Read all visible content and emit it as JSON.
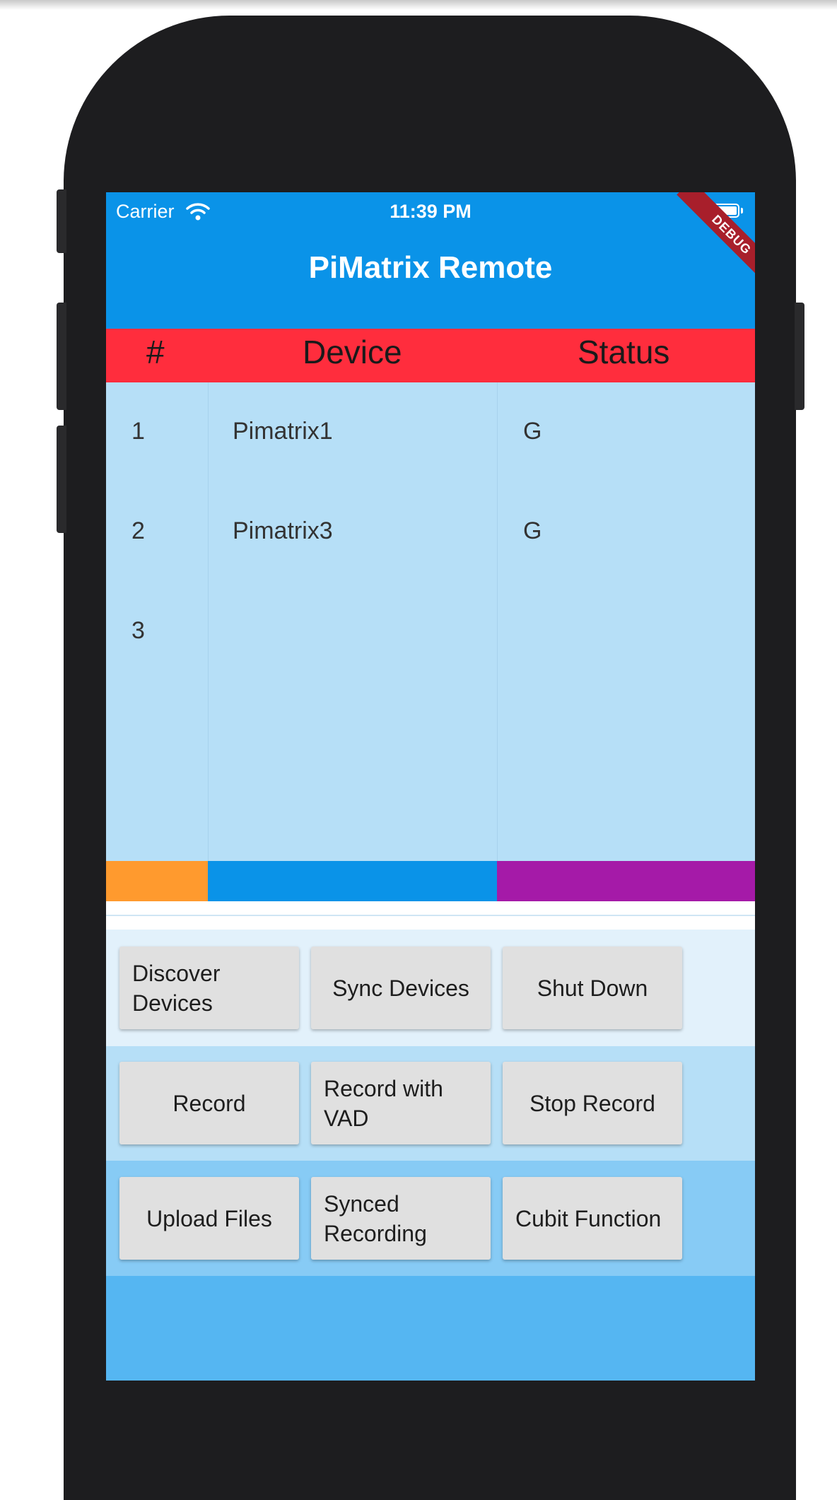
{
  "status_bar": {
    "carrier": "Carrier",
    "time": "11:39 PM",
    "wifi_icon": "wifi-icon",
    "battery_icon": "battery-icon"
  },
  "app_bar": {
    "title": "PiMatrix Remote",
    "debug_banner": "DEBUG"
  },
  "table": {
    "headers": [
      "#",
      "Device",
      "Status"
    ],
    "rows": [
      {
        "num": "1",
        "device": "Pimatrix1",
        "status": "G"
      },
      {
        "num": "2",
        "device": "Pimatrix3",
        "status": "G"
      },
      {
        "num": "3",
        "device": "",
        "status": ""
      }
    ]
  },
  "buttons": {
    "row1": [
      "Discover Devices",
      "Sync Devices",
      "Shut Down"
    ],
    "row2": [
      "Record",
      "Record with VAD",
      "Stop Record"
    ],
    "row3": [
      "Upload Files",
      "Synced Recording",
      "Cubit Function"
    ]
  },
  "colors": {
    "app_bar": "#0a93e8",
    "table_header": "#ff2d3d",
    "table_body": "#b6dff7",
    "bar_orange": "#ff9a2e",
    "bar_blue": "#0a93e8",
    "bar_purple": "#a51aa8",
    "row1_bg": "#e2f1fb",
    "row2_bg": "#b6dff7",
    "row3_bg": "#87cbf5",
    "bottom_bg": "#55b6f2",
    "button_bg": "#e0e0e0"
  }
}
